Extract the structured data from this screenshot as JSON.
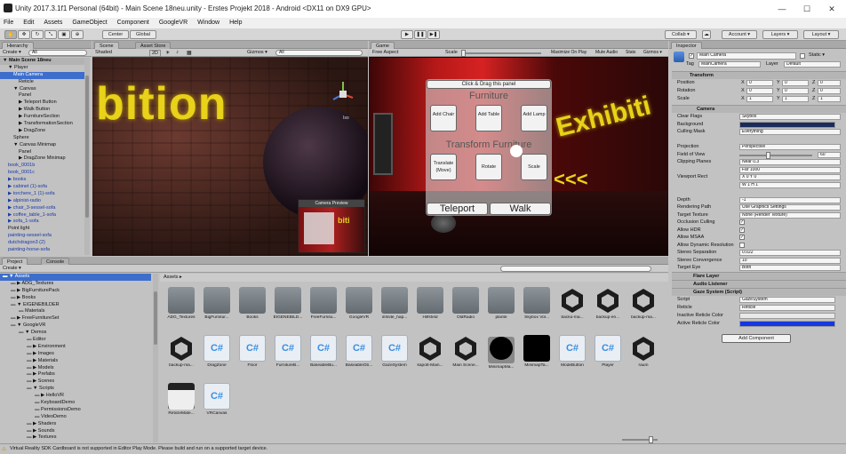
{
  "window": {
    "title": "Unity 2017.3.1f1 Personal (64bit) - Main Scene 18neu.unity - Erstes Projekt 2018 - Android <DX11 on DX9 GPU>",
    "minimize": "—",
    "maximize": "☐",
    "close": "✕"
  },
  "menu": [
    "File",
    "Edit",
    "Assets",
    "GameObject",
    "Component",
    "GoogleVR",
    "Window",
    "Help"
  ],
  "toolbar": {
    "center": "Center",
    "global": "Global",
    "collab": "Collab ▾",
    "account": "Account ▾",
    "layers": "Layers ▾",
    "layout": "Layout ▾"
  },
  "hierarchy": {
    "tab": "Hierarchy",
    "create": "Create ▾",
    "search": "All",
    "items": [
      {
        "t": "▼ Main Scene 18neu",
        "d": 0,
        "b": 1
      },
      {
        "t": "▼ Player",
        "d": 1
      },
      {
        "t": "Main Camera",
        "d": 2,
        "sel": 1
      },
      {
        "t": "Reticle",
        "d": 3
      },
      {
        "t": "▼ Canvas",
        "d": 2
      },
      {
        "t": "Panel",
        "d": 3
      },
      {
        "t": "▶ Teleport Button",
        "d": 3
      },
      {
        "t": "▶ Walk Button",
        "d": 3
      },
      {
        "t": "▶ FurnitureSection",
        "d": 3
      },
      {
        "t": "▶ TransformationSection",
        "d": 3
      },
      {
        "t": "▶ DragZone",
        "d": 3
      },
      {
        "t": "Sphere",
        "d": 2
      },
      {
        "t": "▼ Canvas Minimap",
        "d": 2
      },
      {
        "t": "Panel",
        "d": 3
      },
      {
        "t": "▶ DragZone Minimap",
        "d": 3
      },
      {
        "t": "book_0001b",
        "d": 1,
        "blue": 1
      },
      {
        "t": "book_0001c",
        "d": 1,
        "blue": 1
      },
      {
        "t": "▶ books",
        "d": 1,
        "blue": 1
      },
      {
        "t": "▶ cabinet (1)-sofa",
        "d": 1,
        "blue": 1
      },
      {
        "t": "▶ torchere_1 (1)-sofa",
        "d": 1,
        "blue": 1
      },
      {
        "t": "▶ alpinist-radio",
        "d": 1,
        "blue": 1
      },
      {
        "t": "▶ chair_3-sessel-sofa",
        "d": 1,
        "blue": 1
      },
      {
        "t": "▶ coffee_table_1-sofa",
        "d": 1,
        "blue": 1
      },
      {
        "t": "▶ sofa_1-sofa",
        "d": 1,
        "blue": 1
      },
      {
        "t": "Point light",
        "d": 1
      },
      {
        "t": "painting-sessel-sofa",
        "d": 1,
        "blue": 1
      },
      {
        "t": "dutchdragon3 (2)",
        "d": 1,
        "blue": 1
      },
      {
        "t": "painting-horse-sofa",
        "d": 1,
        "blue": 1
      }
    ]
  },
  "scene": {
    "tab": "Scene",
    "tab2": "Asset Store",
    "shading": "Shaded",
    "mode2d": "2D",
    "gizmos": "Gizmos ▾",
    "search": "All",
    "persp": "Iso",
    "wall_text": "bition",
    "preview_title": "Camera Preview"
  },
  "game": {
    "tab": "Game",
    "aspect": "Free Aspect",
    "scale_label": "Scale",
    "toggles": [
      "Maximize On Play",
      "Mute Audio",
      "Stats",
      "Gizmos ▾"
    ],
    "drag_label": "Click & Drag this panel",
    "furniture_title": "Furniture",
    "furniture_buttons": [
      "Add Chair",
      "Add Table",
      "Add Lamp"
    ],
    "transform_title": "Transform Furniture",
    "transform_buttons": [
      "Translate (Move)",
      "Rotate",
      "Scale"
    ],
    "teleport": "Teleport",
    "walk": "Walk",
    "wall_text": "Exhibiti",
    "arrows": "<<<"
  },
  "project": {
    "tab": "Project",
    "tab2": "Console",
    "create": "Create ▾",
    "tree": [
      {
        "t": "▼ Assets",
        "d": 0,
        "sel": 1
      },
      {
        "t": "▶ ADG_Textures",
        "d": 1
      },
      {
        "t": "▶ BigFurniturePack",
        "d": 1
      },
      {
        "t": "▶ Books",
        "d": 1
      },
      {
        "t": "▼ EIGENEBILDER",
        "d": 1
      },
      {
        "t": "Materials",
        "d": 2
      },
      {
        "t": "▶ FreeFurnitureSet",
        "d": 1
      },
      {
        "t": "▼ GoogleVR",
        "d": 1
      },
      {
        "t": "▼ Demos",
        "d": 2
      },
      {
        "t": "Editor",
        "d": 3
      },
      {
        "t": "▶ Environment",
        "d": 3
      },
      {
        "t": "▶ Images",
        "d": 3
      },
      {
        "t": "▶ Materials",
        "d": 3
      },
      {
        "t": "▶ Models",
        "d": 3
      },
      {
        "t": "▶ Prefabs",
        "d": 3
      },
      {
        "t": "▶ Scenes",
        "d": 3
      },
      {
        "t": "▼ Scripts",
        "d": 3
      },
      {
        "t": "▶ HelloVR",
        "d": 4
      },
      {
        "t": "KeyboardDemo",
        "d": 4
      },
      {
        "t": "PermissionsDemo",
        "d": 4
      },
      {
        "t": "VideoDemo",
        "d": 4
      },
      {
        "t": "▶ Shaders",
        "d": 3
      },
      {
        "t": "▶ Sounds",
        "d": 3
      },
      {
        "t": "▶ Textures",
        "d": 3
      }
    ],
    "breadcrumb": "Assets ▸",
    "assets": [
      {
        "n": "ADG_Textures",
        "k": "folder"
      },
      {
        "n": "BigFurnitur...",
        "k": "folder"
      },
      {
        "n": "Books",
        "k": "folder"
      },
      {
        "n": "EIGENEBILD...",
        "k": "folder"
      },
      {
        "n": "FreeFurnitu...",
        "k": "folder"
      },
      {
        "n": "GoogleVR",
        "k": "folder"
      },
      {
        "n": "infinite_hap...",
        "k": "folder"
      },
      {
        "n": "Hilfsfeld",
        "k": "folder"
      },
      {
        "n": "OldRadio",
        "k": "folder"
      },
      {
        "n": "plante",
        "k": "folder"
      },
      {
        "n": "Skybox Vol...",
        "k": "folder"
      },
      {
        "n": "backu-ma...",
        "k": "unity"
      },
      {
        "n": "backup-en...",
        "k": "unity"
      },
      {
        "n": "backup-ma...",
        "k": "unity"
      },
      {
        "n": "backup-ma...",
        "k": "unity"
      },
      {
        "n": "DragZone",
        "k": "script"
      },
      {
        "n": "Floor",
        "k": "script"
      },
      {
        "n": "FurnitureB...",
        "k": "script"
      },
      {
        "n": "BaseableBu...",
        "k": "script"
      },
      {
        "n": "BaseableOb...",
        "k": "script"
      },
      {
        "n": "GazeSystem",
        "k": "script"
      },
      {
        "n": "kapott-Main...",
        "k": "unity"
      },
      {
        "n": "Main Scene...",
        "k": "unity"
      },
      {
        "n": "MinimapMa...",
        "k": "black-circle"
      },
      {
        "n": "MinimapTa...",
        "k": "black"
      },
      {
        "n": "ModeButton",
        "k": "script"
      },
      {
        "n": "Player",
        "k": "script"
      },
      {
        "n": "raum",
        "k": "unity"
      },
      {
        "n": "ReticleMate...",
        "k": "reticle"
      },
      {
        "n": "VRCanvas",
        "k": "script"
      }
    ]
  },
  "status": "Virtual Reality SDK Cardboard is not supported in Editor Play Mode. Please build and run on a supported target device.",
  "inspector": {
    "tab": "Inspector",
    "name": "Main Camera",
    "static": "Static ▾",
    "tag_label": "Tag",
    "tag": "MainCamera",
    "layer_label": "Layer",
    "layer": "Default",
    "transform": {
      "title": "Transform",
      "rows": [
        {
          "l": "Position",
          "x": "0",
          "y": "0",
          "z": "0"
        },
        {
          "l": "Rotation",
          "x": "0",
          "y": "0",
          "z": "0"
        },
        {
          "l": "Scale",
          "x": "1",
          "y": "1",
          "z": "1"
        }
      ]
    },
    "camera": {
      "title": "Camera",
      "rows": [
        {
          "l": "Clear Flags",
          "v": "Skybox"
        },
        {
          "l": "Background",
          "v": ""
        },
        {
          "l": "Culling Mask",
          "v": "Everything"
        },
        {
          "l": "",
          "v": ""
        },
        {
          "l": "Projection",
          "v": "Perspective"
        },
        {
          "l": "Field of View",
          "v": "60"
        },
        {
          "l": "Clipping Planes",
          "v": "Near  0.3"
        },
        {
          "l": "",
          "v": "Far  1000"
        },
        {
          "l": "Viewport Rect",
          "v": "X 0      Y 0"
        },
        {
          "l": "",
          "v": "W 1      H 1"
        },
        {
          "l": "",
          "v": ""
        },
        {
          "l": "Depth",
          "v": "-1"
        },
        {
          "l": "Rendering Path",
          "v": "Use Graphics Settings"
        },
        {
          "l": "Target Texture",
          "v": "None (Render Texture)"
        },
        {
          "l": "Occlusion Culling",
          "v": "✓"
        },
        {
          "l": "Allow HDR",
          "v": "✓"
        },
        {
          "l": "Allow MSAA",
          "v": "✓"
        },
        {
          "l": "Allow Dynamic Resolution",
          "v": ""
        },
        {
          "l": "Stereo Separation",
          "v": "0.022"
        },
        {
          "l": "Stereo Convergence",
          "v": "10"
        },
        {
          "l": "Target Eye",
          "v": "Both"
        }
      ]
    },
    "flare": "Flare Layer",
    "audio": "Audio Listener",
    "gaze": {
      "title": "Gaze System (Script)",
      "rows": [
        {
          "l": "Script",
          "v": "GazeSystem"
        },
        {
          "l": "Reticle",
          "v": "Reticle"
        },
        {
          "l": "Inactive Reticle Color",
          "v": ""
        },
        {
          "l": "Active Reticle Color",
          "v": ""
        }
      ]
    },
    "add_component": "Add Component"
  },
  "colors": {
    "selection": "#3d6ecc",
    "background_swatch": "#1a2c5a",
    "active_reticle": "#1636e0",
    "inactive_reticle": "#e8e8e8",
    "wall_text": "#e8d21a"
  }
}
